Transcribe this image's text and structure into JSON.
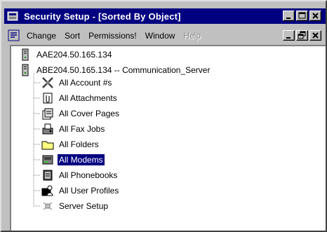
{
  "window": {
    "title": "Security Setup - [Sorted By Object]"
  },
  "menu": {
    "items": [
      {
        "label": "Change",
        "enabled": true
      },
      {
        "label": "Sort",
        "enabled": true
      },
      {
        "label": "Permissions!",
        "enabled": true
      },
      {
        "label": "Window",
        "enabled": true
      },
      {
        "label": "Help",
        "enabled": false
      }
    ]
  },
  "tree": {
    "servers": [
      {
        "label": "AAE204.50.165.134",
        "icon": "server-icon"
      },
      {
        "label": "ABE204.50.165.134 -- Communication_Server",
        "icon": "server-icon"
      }
    ],
    "children": [
      {
        "label": "All Account #s",
        "icon": "account-icon",
        "selected": false
      },
      {
        "label": "All Attachments",
        "icon": "attachment-icon",
        "selected": false
      },
      {
        "label": "All Cover Pages",
        "icon": "cover-page-icon",
        "selected": false
      },
      {
        "label": "All Fax Jobs",
        "icon": "fax-job-icon",
        "selected": false
      },
      {
        "label": "All Folders",
        "icon": "folder-icon",
        "selected": false
      },
      {
        "label": "All Modems",
        "icon": "modem-icon",
        "selected": true
      },
      {
        "label": "All Phonebooks",
        "icon": "phonebook-icon",
        "selected": false
      },
      {
        "label": "All User Profiles",
        "icon": "user-profile-icon",
        "selected": false
      },
      {
        "label": "Server Setup",
        "icon": "server-setup-icon",
        "selected": false
      }
    ]
  },
  "colors": {
    "titlebar": "#000080",
    "selection": "#000080",
    "face": "#c0c0c0"
  }
}
